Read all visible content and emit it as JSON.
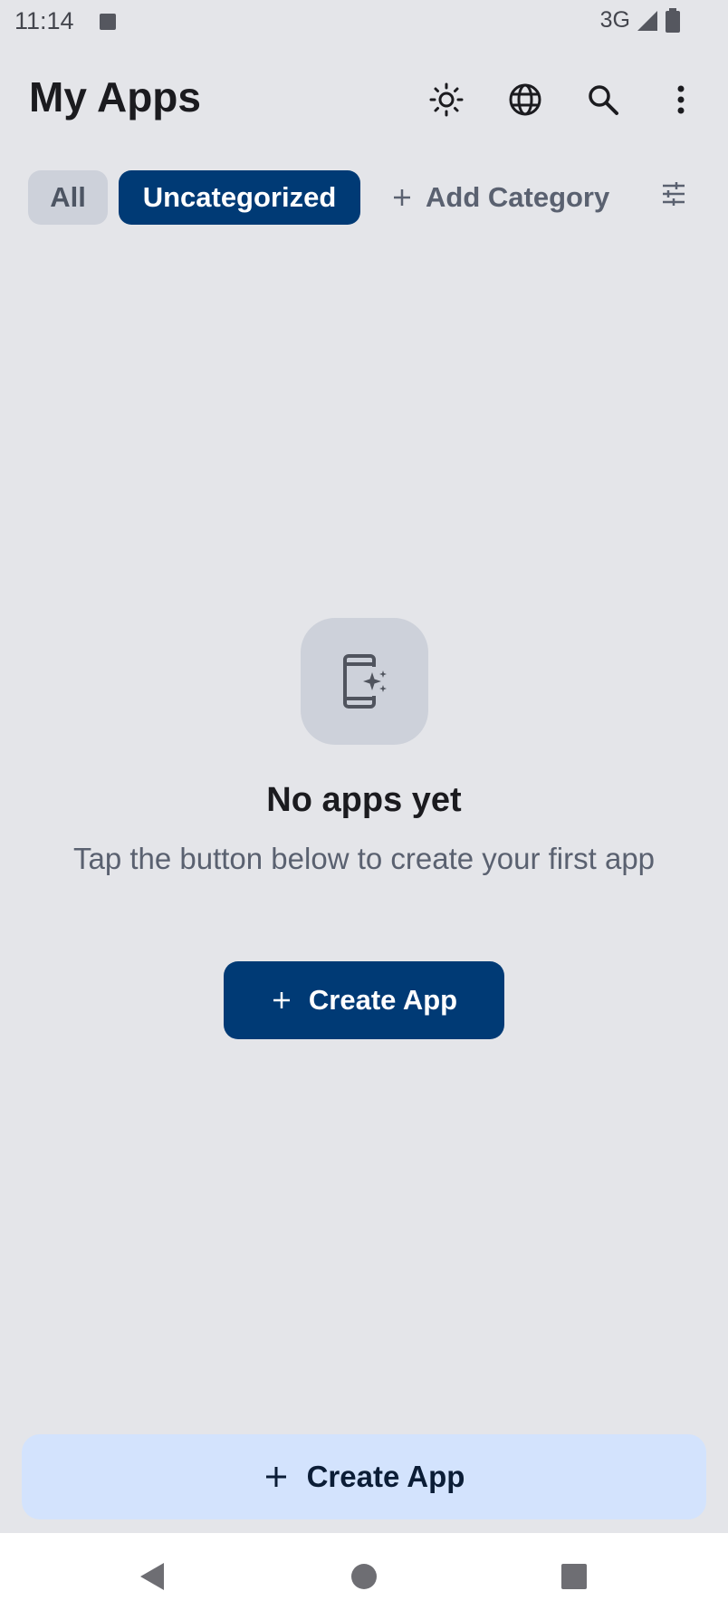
{
  "status_bar": {
    "time": "11:14",
    "network": "3G"
  },
  "app_bar": {
    "title": "My Apps",
    "actions": [
      "brightness-icon",
      "globe-icon",
      "search-icon",
      "more-vert-icon"
    ]
  },
  "categories": {
    "chips": [
      {
        "label": "All",
        "selected": false
      },
      {
        "label": "Uncategorized",
        "selected": true
      }
    ],
    "add_label": "Add Category"
  },
  "empty_state": {
    "icon": "phone-sparkle-icon",
    "title": "No apps yet",
    "subtitle": "Tap the button below to create your first app",
    "button_label": "Create App"
  },
  "bottom_button": {
    "label": "Create App"
  },
  "colors": {
    "background": "#E4E5E9",
    "primary": "#003A75",
    "chip_inactive": "#CDD1DA",
    "bottom_button_bg": "#D3E3FD"
  }
}
